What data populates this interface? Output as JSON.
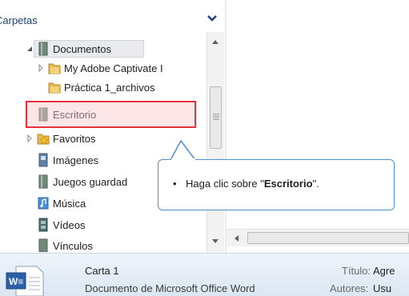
{
  "folders_pane": {
    "title": "Carpetas",
    "items": [
      {
        "label": "Documentos",
        "icon": "library-icon"
      },
      {
        "label": "My Adobe Captivate I",
        "icon": "folder-icon"
      },
      {
        "label": "Práctica 1_archivos",
        "icon": "folder-icon"
      },
      {
        "label": "Escritorio",
        "icon": "library-icon"
      },
      {
        "label": "Favoritos",
        "icon": "favorites-folder-icon"
      },
      {
        "label": "Imágenes",
        "icon": "library-icon"
      },
      {
        "label": "Juegos guardad",
        "icon": "library-icon"
      },
      {
        "label": "Música",
        "icon": "music-library-icon"
      },
      {
        "label": "Vídeos",
        "icon": "video-library-icon"
      },
      {
        "label": "Vínculos",
        "icon": "library-icon"
      }
    ]
  },
  "callout": {
    "prefix": "Haga clic sobre \"",
    "bold": "Escritorio",
    "suffix": "\"."
  },
  "details": {
    "file_name": "Carta 1",
    "file_type": "Documento de Microsoft Office Word",
    "title_label": "Título:",
    "title_value": "Agre",
    "authors_label": "Autores:",
    "authors_value": "Usu"
  },
  "colors": {
    "highlight_border": "#e8313c",
    "callout_border": "#4e8fcf",
    "folder_yellow": "#e8b84a"
  }
}
